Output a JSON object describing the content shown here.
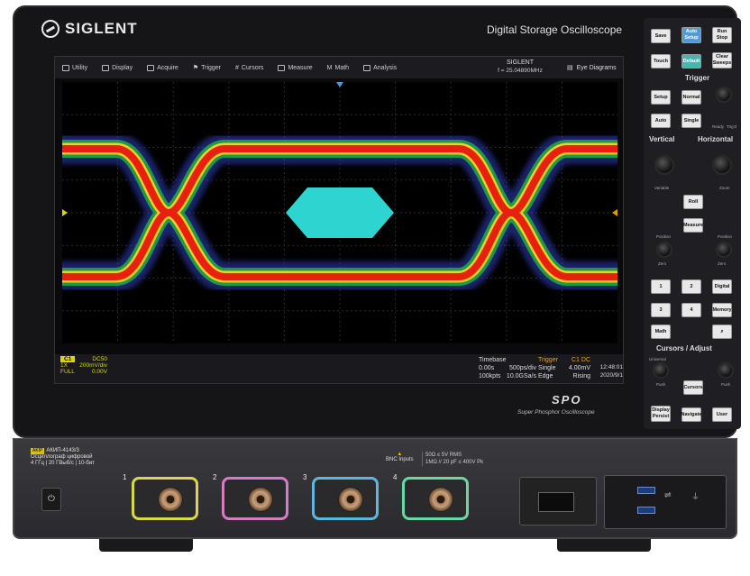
{
  "header": {
    "brand": "SIGLENT",
    "model_title": "Digital Storage Oscilloscope"
  },
  "menu": {
    "items": [
      {
        "label": "Utility",
        "icon": "utility-icon"
      },
      {
        "label": "Display",
        "icon": "display-icon"
      },
      {
        "label": "Acquire",
        "icon": "acquire-icon"
      },
      {
        "label": "Trigger",
        "icon": "trigger-flag-icon"
      },
      {
        "label": "Cursors",
        "icon": "cursors-icon"
      },
      {
        "label": "Measure",
        "icon": "measure-icon"
      },
      {
        "label": "Math",
        "icon": "math-icon"
      },
      {
        "label": "Analysis",
        "icon": "analysis-icon"
      }
    ],
    "brand_box": {
      "title": "SIGLENT",
      "frequency": "f = 25.04890MHz"
    },
    "eye_diagrams": "Eye Diagrams"
  },
  "channel1": {
    "tag": "C1",
    "coupling": "DC50",
    "probe": "1X",
    "scale": "200mV/div",
    "bandwidth": "FULL",
    "offset": "0.00V"
  },
  "timebase": {
    "label": "Timebase",
    "delay": "0.00s",
    "scale": "500ps/div",
    "memory": "100kpts",
    "sample_rate": "10.0GSa/s"
  },
  "trigger_info": {
    "label": "Trigger",
    "source": "C1 DC",
    "mode": "Single",
    "level": "4.00mV",
    "type": "Edge",
    "slope": "Rising"
  },
  "clock": {
    "time": "12:48:01",
    "date": "2020/9/1"
  },
  "panel": {
    "buttons": {
      "save": "Save",
      "auto_setup": "Auto Setup",
      "run_stop": "Run Stop",
      "touch": "Touch",
      "default": "Default",
      "clear_sweeps": "Clear Sweeps",
      "setup": "Setup",
      "normal": "Normal",
      "auto": "Auto",
      "single": "Single",
      "roll": "Roll",
      "measure": "Measure",
      "ch1": "1",
      "ch2": "2",
      "ch3": "3",
      "ch4": "4",
      "digital": "Digital",
      "memory": "Memory",
      "math": "Math",
      "cursors": "Cursors",
      "display_persist": "Display Persist",
      "navigate": "Navigate",
      "user": "User"
    },
    "labels": {
      "trigger": "Trigger",
      "vertical": "Vertical",
      "horizontal": "Horizontal",
      "cursors_adjust": "Cursors / Adjust",
      "ready": "Ready",
      "trigd": "Trig'd",
      "variable": "Variable",
      "zoom": "Zoom",
      "position": "Position",
      "zero": "Zero",
      "universal": "Universal",
      "push": "Push"
    }
  },
  "branding": {
    "spo": "SPO",
    "spo_sub": "Super Phosphor Oscilloscope"
  },
  "front": {
    "model_line1": "АКИП-4143/3",
    "model_line2": "Осциллограф цифровой",
    "model_line3": "4 ГГц | 20 ГВыб/с | 10-бит",
    "bnc_title": "BNC Inputs",
    "bnc_spec1": "50Ω ≤ 5V RMS",
    "bnc_spec2": "1MΩ // 20 pF ≤ 400V Pk",
    "channels": [
      {
        "num": "1",
        "color": "#d8d84a"
      },
      {
        "num": "2",
        "color": "#d87ac8"
      },
      {
        "num": "3",
        "color": "#5ab8e0"
      },
      {
        "num": "4",
        "color": "#6ad8a0"
      }
    ],
    "power_symbol": "⏻"
  },
  "colors": {
    "accent_blue": "#4f9ad8",
    "accent_teal": "#47b8b0",
    "eye_mask": "#2ed4d0",
    "ch1_yellow": "#d8d800"
  }
}
